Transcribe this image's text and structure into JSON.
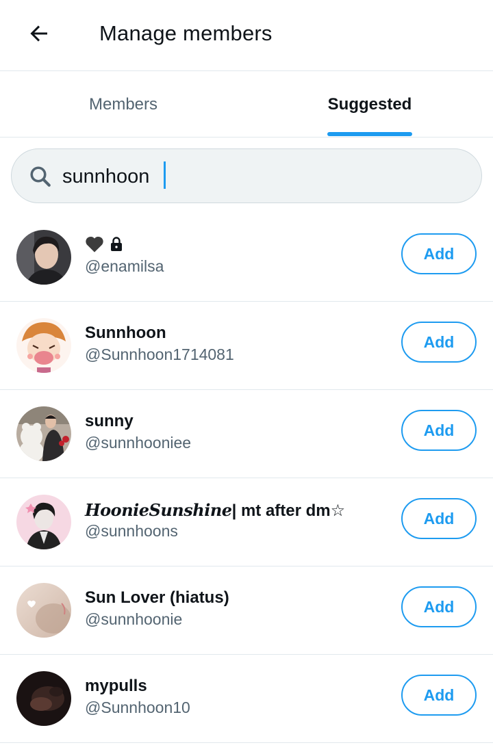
{
  "header": {
    "title": "Manage members",
    "back_icon": "arrow-left-icon"
  },
  "tabs": [
    {
      "label": "Members",
      "selected": false
    },
    {
      "label": "Suggested",
      "selected": true
    }
  ],
  "search": {
    "value": "sunnhoon",
    "icon": "search-icon"
  },
  "accent_color": "#1d9bf0",
  "users": [
    {
      "name": "🖤",
      "name_icons": [
        "black-heart-icon",
        "lock-icon"
      ],
      "handle": "@enamilsa",
      "button": "Add"
    },
    {
      "name": "Sunnhoon",
      "handle": "@Sunnhoon1714081",
      "button": "Add"
    },
    {
      "name": "sunny",
      "handle": "@sunnhooniee",
      "button": "Add"
    },
    {
      "name_script": "HoonieSunshine",
      "name": "| mt after dm☆",
      "handle": "@sunnhoons",
      "button": "Add"
    },
    {
      "name": "Sun Lover (hiatus)",
      "handle": "@sunnhoonie",
      "button": "Add"
    },
    {
      "name": "mypulls",
      "handle": "@Sunnhoon10",
      "button": "Add"
    }
  ]
}
